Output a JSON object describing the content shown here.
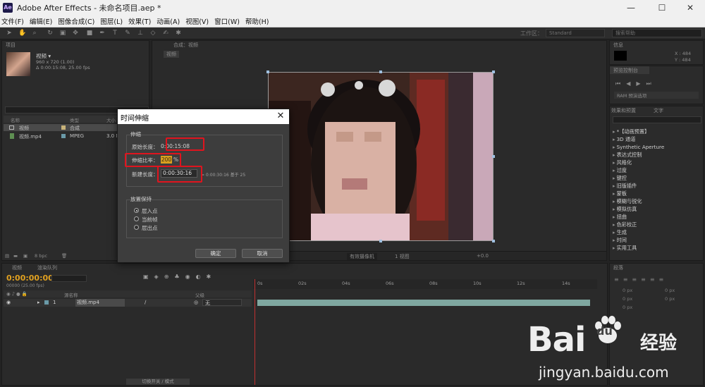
{
  "window": {
    "app_icon": "Ae",
    "title": "Adobe After Effects - 未命名项目.aep *",
    "minimize": "—",
    "maximize": "☐",
    "close": "✕"
  },
  "menu": [
    "文件(F)",
    "编辑(E)",
    "图像合成(C)",
    "图层(L)",
    "效果(T)",
    "动画(A)",
    "视图(V)",
    "窗口(W)",
    "帮助(H)"
  ],
  "toolbar": {
    "workspace_label": "工作区：",
    "workspace_value": "Standard",
    "search_placeholder": "搜索帮助"
  },
  "project": {
    "tab": "项目",
    "item_name": "视频 ▾",
    "item_res": "960 x 720 (1.00)",
    "item_duration": "Δ 0:00:15:08, 25.00 fps",
    "columns": {
      "name": "名称",
      "type": "类型",
      "size": "大小"
    },
    "rows": [
      {
        "name": "视频",
        "type": "合成",
        "size": "",
        "swatch": "#c8b37a"
      },
      {
        "name": "视频.mp4",
        "type": "MPEG",
        "size": "3.0 M",
        "swatch": "#6a9aa8"
      }
    ],
    "bpc": "8 bpc"
  },
  "composition": {
    "tab": "合成：视频",
    "sub_tab": "视频",
    "bottom_text": "有效摄像机",
    "view_text": "1 视图",
    "offset_text": "+0.0"
  },
  "info_panel": {
    "tab": "信息",
    "x_text": "X : 484",
    "y_text": "Y : 484"
  },
  "preview_panel": {
    "tab": "预览控制台",
    "ram_label": "RAM 预演选项"
  },
  "effects_panel": {
    "tab1": "效果和预置",
    "tab2": "文字",
    "items": [
      "*【动画预置】",
      "3D 通道",
      "Synthetic Aperture",
      "表达式控制",
      "风格化",
      "过度",
      "键控",
      "旧版插件",
      "蒙板",
      "模糊与锐化",
      "模拟仿真",
      "扭曲",
      "色彩校正",
      "生成",
      "时间",
      "实用工具"
    ]
  },
  "paragraph_panel": {
    "tab": "段落",
    "values": [
      "0 px",
      "0 px",
      "0 px",
      "0 px",
      "0 px"
    ]
  },
  "timeline": {
    "tab1": "视频",
    "tab2": "渲染队列",
    "timecode": "0:00:00:00",
    "fps": "00000 (25.00 fps)",
    "ticks": [
      "0s",
      "02s",
      "04s",
      "06s",
      "08s",
      "10s",
      "12s",
      "14s"
    ],
    "col_layer_name": "源名称",
    "col_parent": "父级",
    "layer": {
      "index": "1",
      "name": "视频.mp4",
      "parent": "无"
    },
    "toggle_label": "切换开关 / 模式"
  },
  "dialog": {
    "title": "时间伸缩",
    "stretch_group": "伸缩",
    "original_label": "原始长度：",
    "original_value": "0:00:15:08",
    "ratio_label": "伸缩比率：",
    "ratio_value": "200",
    "ratio_unit": "%",
    "new_label": "新建长度：",
    "new_value": "0:00:30:16",
    "new_hint": "= 0:00:30:16  基于 25",
    "hold_group": "放置保持",
    "hold_options": [
      "层入点",
      "当前帧",
      "层出点"
    ],
    "ok": "确定",
    "cancel": "取消"
  },
  "watermark": {
    "bai": "Bai",
    "du": "du",
    "jingyan": "经验",
    "url": "jingyan.baidu.com"
  }
}
